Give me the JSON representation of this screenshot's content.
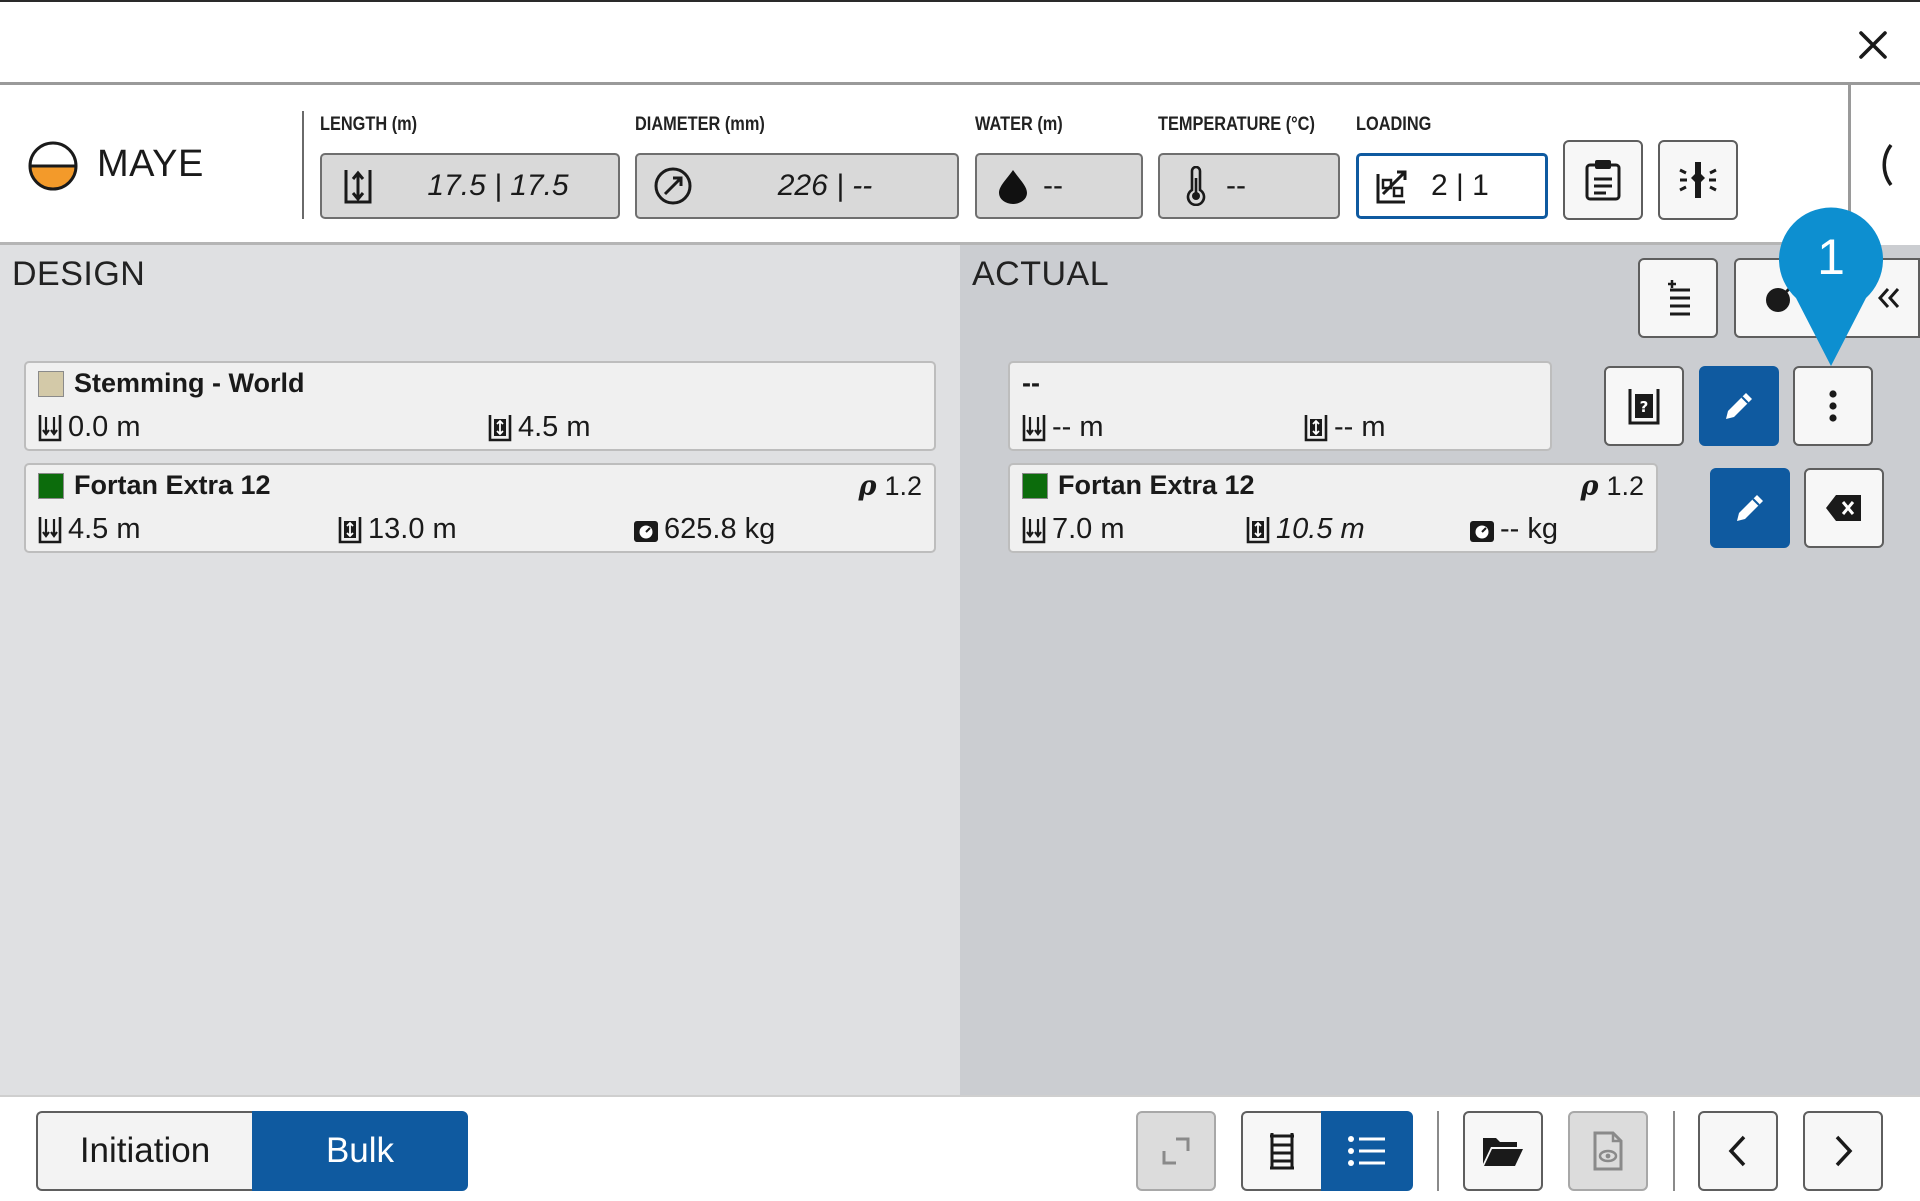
{
  "hole": {
    "name": "MAYE"
  },
  "fields": {
    "length": {
      "label": "LENGTH (m)",
      "value": "17.5 | 17.5"
    },
    "diameter": {
      "label": "DIAMETER (mm)",
      "value": "226 | --"
    },
    "water": {
      "label": "WATER (m)",
      "value": "--"
    },
    "temperature": {
      "label": "TEMPERATURE (°C)",
      "value": "--"
    },
    "loading": {
      "label": "LOADING",
      "value": "2 | 1"
    }
  },
  "design": {
    "title": "DESIGN",
    "decks": [
      {
        "name": "Stemming - World",
        "color": "#d3c9a8",
        "top": "0.0 m",
        "length": "4.5 m"
      },
      {
        "name": "Fortan Extra 12",
        "color": "#0c6c0c",
        "density": "1.2",
        "top": "4.5 m",
        "length": "13.0 m",
        "mass": "625.8 kg"
      }
    ]
  },
  "actual": {
    "title": "ACTUAL",
    "decks": [
      {
        "name": "--",
        "top": "-- m",
        "length": "-- m"
      },
      {
        "name": "Fortan Extra 12",
        "color": "#0c6c0c",
        "density": "1.2",
        "top": "7.0 m",
        "length": "10.5 m",
        "mass": "-- kg"
      }
    ]
  },
  "callout": {
    "number": "1"
  },
  "bottom": {
    "modes": [
      "Initiation",
      "Bulk"
    ],
    "active_mode": "Bulk"
  },
  "colors": {
    "accent": "#0f5aa0",
    "callout": "#0d8fd0",
    "design_bg": "#dfe0e2",
    "actual_bg": "#cbcdd1"
  }
}
